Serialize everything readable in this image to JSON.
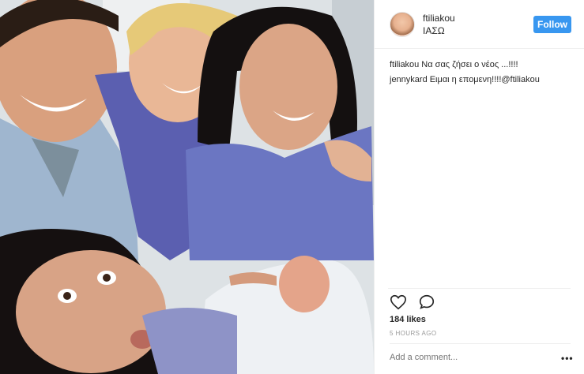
{
  "post": {
    "username": "ftiliakou",
    "location": "ΙΑΣΩ",
    "follow_label": "Follow",
    "comments": [
      {
        "user": "ftiliakou",
        "text": "Να σας ζήσει ο νέος ...!!!!"
      },
      {
        "user": "jennykard",
        "text": "Ειμαι η επομενη!!!!@ftiliakou"
      }
    ],
    "likes": "184 likes",
    "timestamp": "5 HOURS AGO",
    "comment_placeholder": "Add a comment...",
    "more_glyph": "•••"
  },
  "icons": {
    "like": "heart-icon",
    "comment": "speech-bubble-icon",
    "more": "more-options-icon"
  },
  "colors": {
    "follow_button": "#3897f0",
    "text": "#262626",
    "muted": "#999999",
    "divider": "#efefef"
  }
}
